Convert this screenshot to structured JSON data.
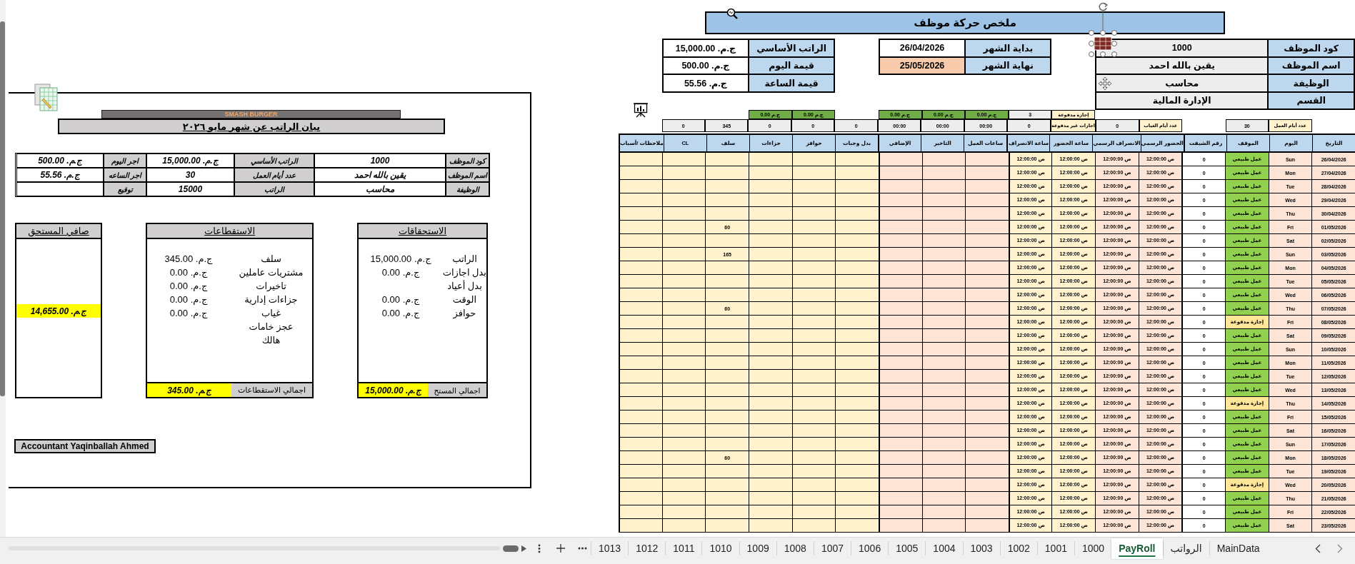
{
  "payslip": {
    "company": "SMASH BURGER",
    "title": "بيان الراتب عن شهر مايو ٢٠٢٦",
    "info_rows": [
      [
        {
          "label": "كود الموظف",
          "value": "1000"
        },
        {
          "label": "الراتب الأساسي",
          "value": "ج.م. 15,000.00"
        },
        {
          "label": "اجر اليوم",
          "value": "ج.م. 500.00"
        }
      ],
      [
        {
          "label": "اسم الموظف",
          "value": "يقين بالله احمد"
        },
        {
          "label": "عدد أيام العمل",
          "value": "30"
        },
        {
          "label": "اجر الساعه",
          "value": "ج.م. 55.56"
        }
      ],
      [
        {
          "label": "الوظيفة",
          "value": "محاسب"
        },
        {
          "label": "الراتب",
          "value": "15000"
        },
        {
          "label": "توقيع"
        }
      ]
    ],
    "earnings": {
      "title": "الاستحقاقات",
      "items": [
        {
          "label": "الراتب",
          "value": "ج.م. 15,000.00"
        },
        {
          "label": "بدل اجازات",
          "value": "ج.م. 0.00"
        },
        {
          "label": "بدل أعياد"
        },
        {
          "label": "الوقت",
          "value": "ج.م. 0.00"
        },
        {
          "label": "حوافز",
          "value": "ج.م. 0.00"
        }
      ],
      "total_label": "اجمالي المستح",
      "total": "ج.م. 15,000.00"
    },
    "deductions": {
      "title": "الاستقطاعات",
      "items": [
        {
          "label": "سلف",
          "value": "ج.م. 345.00"
        },
        {
          "label": "مشتريات عاملين",
          "value": "ج.م. 0.00"
        },
        {
          "label": "تاخيرات",
          "value": "ج.م. 0.00"
        },
        {
          "label": "جزاءات إدارية",
          "value": "ج.م. 0.00"
        },
        {
          "label": "غياب",
          "value": "ج.م. 0.00"
        },
        {
          "label": "عجز خامات"
        },
        {
          "label": "هالك"
        }
      ],
      "total_label": "اجمالي الاستقطاعات",
      "total": "ج.م. 345.00"
    },
    "net": {
      "title": "صافي المستحق",
      "value": "ج.م. 14,655.00"
    },
    "signature": "Accountant Yaqinballah Ahmed"
  },
  "summary": {
    "title": "ملخص حركة موظف",
    "employee_rows": [
      {
        "label": "كود الموظف",
        "value": "1000"
      },
      {
        "label": "اسم الموظف",
        "value": "يقين بالله احمد"
      },
      {
        "label": "الوظيفة",
        "value": "محاسب"
      },
      {
        "label": "القسم",
        "value": "الإدارة المالية"
      }
    ],
    "period_rows": [
      {
        "label": "بداية الشهر",
        "value": "26/04/2026",
        "highlighted": false
      },
      {
        "label": "نهاية الشهر",
        "value": "25/05/2026",
        "highlighted": true
      }
    ],
    "salary_rows": [
      {
        "label": "الراتب الأساسي",
        "value": "ج.م. 15,000.00"
      },
      {
        "label": "قيمة اليوم",
        "value": "ج.م. 500.00"
      },
      {
        "label": "قيمة الساعة",
        "value": "ج.م. 55.56"
      }
    ]
  },
  "attendance": {
    "columns": [
      {
        "label": "التاريخ",
        "kind": "date"
      },
      {
        "label": "اليوم",
        "kind": "day",
        "summary": {
          "kind": "label",
          "text": "عدد أيام العمل"
        }
      },
      {
        "label": "الموقف",
        "kind": "status",
        "summary": {
          "kind": "value",
          "text": "30"
        }
      },
      {
        "label": "رقم الشيفت",
        "kind": "shift"
      },
      {
        "label": "الحضور الرسمي",
        "kind": "official_in",
        "summary": {
          "kind": "label",
          "text": "عدد أيام الغياب"
        }
      },
      {
        "label": "الانصراف الرسمي",
        "kind": "official_out",
        "summary": {
          "kind": "value",
          "text": "0"
        }
      },
      {
        "label": "ساعة الحضور",
        "kind": "actual_in",
        "summary": {
          "kind": "label",
          "text": "اجازات غير مدفوعة"
        },
        "top": {
          "kind": "label",
          "text": "إجازة مدفوعة"
        }
      },
      {
        "label": "ساعة الانصراف",
        "kind": "actual_out",
        "summary": {
          "kind": "value",
          "text": "0"
        },
        "top": {
          "kind": "value",
          "text": "3"
        }
      },
      {
        "label": "ساعات العمل",
        "kind": "work_hours",
        "summary": {
          "kind": "value",
          "text": "00:00"
        },
        "top": {
          "kind": "money",
          "text": "ج.م 0.00"
        }
      },
      {
        "label": "التاخير",
        "kind": "delay",
        "summary": {
          "kind": "value",
          "text": "00:00"
        },
        "top": {
          "kind": "money",
          "text": "ج.م 0.00"
        }
      },
      {
        "label": "الإضافي",
        "kind": "overtime",
        "summary": {
          "kind": "value",
          "text": "00:00"
        },
        "top": {
          "kind": "money",
          "text": "ج.م 0.00"
        }
      },
      {
        "label": "بدل وجبات",
        "kind": "meal",
        "summary": {
          "kind": "value",
          "text": "0"
        }
      },
      {
        "label": "حوافز",
        "kind": "bonus",
        "summary": {
          "kind": "value",
          "text": "0"
        },
        "top": {
          "kind": "money",
          "text": "ج.م 0.00"
        }
      },
      {
        "label": "جزاءات",
        "kind": "penalty",
        "summary": {
          "kind": "value",
          "text": "0"
        },
        "top": {
          "kind": "money",
          "text": "ج.م 0.00"
        }
      },
      {
        "label": "سلف",
        "kind": "advance",
        "summary": {
          "kind": "value",
          "text": "345"
        }
      },
      {
        "label": "CL",
        "kind": "cl",
        "summary": {
          "kind": "value",
          "text": "0"
        }
      },
      {
        "label": "ملاحظات /أسباب",
        "kind": "notes"
      }
    ],
    "rows": [
      {
        "date": "26/04/2026",
        "day": "Sun",
        "status": "عمل طبيعي",
        "color": "#92d050",
        "shift": "0",
        "official_in": "12:00:00 ص",
        "official_out": "12:00:00 ص",
        "actual_in": "12:00:00 ص",
        "actual_out": "12:00:00 ص"
      },
      {
        "date": "27/04/2026",
        "day": "Mon",
        "status": "عمل طبيعي",
        "color": "#92d050",
        "shift": "0",
        "official_in": "12:00:00 ص",
        "official_out": "12:00:00 ص",
        "actual_in": "12:00:00 ص",
        "actual_out": "12:00:00 ص"
      },
      {
        "date": "28/04/2026",
        "day": "Tue",
        "status": "عمل طبيعي",
        "color": "#92d050",
        "shift": "0",
        "official_in": "12:00:00 ص",
        "official_out": "12:00:00 ص",
        "actual_in": "12:00:00 ص",
        "actual_out": "12:00:00 ص"
      },
      {
        "date": "29/04/2026",
        "day": "Wed",
        "status": "عمل طبيعي",
        "color": "#92d050",
        "shift": "0",
        "official_in": "12:00:00 ص",
        "official_out": "12:00:00 ص",
        "actual_in": "12:00:00 ص",
        "actual_out": "12:00:00 ص"
      },
      {
        "date": "30/04/2026",
        "day": "Thu",
        "status": "عمل طبيعي",
        "color": "#92d050",
        "shift": "0",
        "official_in": "12:00:00 ص",
        "official_out": "12:00:00 ص",
        "actual_in": "12:00:00 ص",
        "actual_out": "12:00:00 ص"
      },
      {
        "date": "01/05/2026",
        "day": "Fri",
        "status": "عمل طبيعي",
        "color": "#92d050",
        "shift": "0",
        "official_in": "12:00:00 ص",
        "official_out": "12:00:00 ص",
        "actual_in": "12:00:00 ص",
        "actual_out": "12:00:00 ص",
        "advance": "60"
      },
      {
        "date": "02/05/2026",
        "day": "Sat",
        "status": "عمل طبيعي",
        "color": "#92d050",
        "shift": "0",
        "official_in": "12:00:00 ص",
        "official_out": "12:00:00 ص",
        "actual_in": "12:00:00 ص",
        "actual_out": "12:00:00 ص"
      },
      {
        "date": "03/05/2026",
        "day": "Sun",
        "status": "عمل طبيعي",
        "color": "#92d050",
        "shift": "0",
        "official_in": "12:00:00 ص",
        "official_out": "12:00:00 ص",
        "actual_in": "12:00:00 ص",
        "actual_out": "12:00:00 ص",
        "advance": "165"
      },
      {
        "date": "04/05/2026",
        "day": "Mon",
        "status": "عمل طبيعي",
        "color": "#92d050",
        "shift": "0",
        "official_in": "12:00:00 ص",
        "official_out": "12:00:00 ص",
        "actual_in": "12:00:00 ص",
        "actual_out": "12:00:00 ص"
      },
      {
        "date": "05/05/2026",
        "day": "Tue",
        "status": "عمل طبيعي",
        "color": "#92d050",
        "shift": "0",
        "official_in": "12:00:00 ص",
        "official_out": "12:00:00 ص",
        "actual_in": "12:00:00 ص",
        "actual_out": "12:00:00 ص"
      },
      {
        "date": "06/05/2026",
        "day": "Wed",
        "status": "عمل طبيعي",
        "color": "#92d050",
        "shift": "0",
        "official_in": "12:00:00 ص",
        "official_out": "12:00:00 ص",
        "actual_in": "12:00:00 ص",
        "actual_out": "12:00:00 ص"
      },
      {
        "date": "07/05/2026",
        "day": "Thu",
        "status": "عمل طبيعي",
        "color": "#92d050",
        "shift": "0",
        "official_in": "12:00:00 ص",
        "official_out": "12:00:00 ص",
        "actual_in": "12:00:00 ص",
        "actual_out": "12:00:00 ص",
        "advance": "60"
      },
      {
        "date": "08/05/2026",
        "day": "Fri",
        "status": "إجازة مدفوعة",
        "color": "#ffe699",
        "shift": "0",
        "official_in": "12:00:00 ص",
        "official_out": "12:00:00 ص",
        "actual_in": "12:00:00 ص",
        "actual_out": "12:00:00 ص"
      },
      {
        "date": "09/05/2026",
        "day": "Sat",
        "status": "عمل طبيعي",
        "color": "#92d050",
        "shift": "0",
        "official_in": "12:00:00 ص",
        "official_out": "12:00:00 ص",
        "actual_in": "12:00:00 ص",
        "actual_out": "12:00:00 ص"
      },
      {
        "date": "10/05/2026",
        "day": "Sun",
        "status": "عمل طبيعي",
        "color": "#92d050",
        "shift": "0",
        "official_in": "12:00:00 ص",
        "official_out": "12:00:00 ص",
        "actual_in": "12:00:00 ص",
        "actual_out": "12:00:00 ص"
      },
      {
        "date": "11/05/2026",
        "day": "Mon",
        "status": "عمل طبيعي",
        "color": "#92d050",
        "shift": "0",
        "official_in": "12:00:00 ص",
        "official_out": "12:00:00 ص",
        "actual_in": "12:00:00 ص",
        "actual_out": "12:00:00 ص"
      },
      {
        "date": "12/05/2026",
        "day": "Tue",
        "status": "عمل طبيعي",
        "color": "#92d050",
        "shift": "0",
        "official_in": "12:00:00 ص",
        "official_out": "12:00:00 ص",
        "actual_in": "12:00:00 ص",
        "actual_out": "12:00:00 ص"
      },
      {
        "date": "13/05/2026",
        "day": "Wed",
        "status": "عمل طبيعي",
        "color": "#92d050",
        "shift": "0",
        "official_in": "12:00:00 ص",
        "official_out": "12:00:00 ص",
        "actual_in": "12:00:00 ص",
        "actual_out": "12:00:00 ص"
      },
      {
        "date": "14/05/2026",
        "day": "Thu",
        "status": "إجازة مدفوعة",
        "color": "#ffe699",
        "shift": "0",
        "official_in": "12:00:00 ص",
        "official_out": "12:00:00 ص",
        "actual_in": "12:00:00 ص",
        "actual_out": "12:00:00 ص"
      },
      {
        "date": "15/05/2026",
        "day": "Fri",
        "status": "عمل طبيعي",
        "color": "#92d050",
        "shift": "0",
        "official_in": "12:00:00 ص",
        "official_out": "12:00:00 ص",
        "actual_in": "12:00:00 ص",
        "actual_out": "12:00:00 ص"
      },
      {
        "date": "16/05/2026",
        "day": "Sat",
        "status": "عمل طبيعي",
        "color": "#92d050",
        "shift": "0",
        "official_in": "12:00:00 ص",
        "official_out": "12:00:00 ص",
        "actual_in": "12:00:00 ص",
        "actual_out": "12:00:00 ص"
      },
      {
        "date": "17/05/2026",
        "day": "Sun",
        "status": "عمل طبيعي",
        "color": "#92d050",
        "shift": "0",
        "official_in": "12:00:00 ص",
        "official_out": "12:00:00 ص",
        "actual_in": "12:00:00 ص",
        "actual_out": "12:00:00 ص"
      },
      {
        "date": "18/05/2026",
        "day": "Mon",
        "status": "عمل طبيعي",
        "color": "#92d050",
        "shift": "0",
        "official_in": "12:00:00 ص",
        "official_out": "12:00:00 ص",
        "actual_in": "12:00:00 ص",
        "actual_out": "12:00:00 ص",
        "advance": "60"
      },
      {
        "date": "19/05/2026",
        "day": "Tue",
        "status": "عمل طبيعي",
        "color": "#92d050",
        "shift": "0",
        "official_in": "12:00:00 ص",
        "official_out": "12:00:00 ص",
        "actual_in": "12:00:00 ص",
        "actual_out": "12:00:00 ص"
      },
      {
        "date": "20/05/2026",
        "day": "Wed",
        "status": "إجازة مدفوعة",
        "color": "#ffe699",
        "shift": "0",
        "official_in": "12:00:00 ص",
        "official_out": "12:00:00 ص",
        "actual_in": "12:00:00 ص",
        "actual_out": "12:00:00 ص"
      },
      {
        "date": "21/05/2026",
        "day": "Thu",
        "status": "عمل طبيعي",
        "color": "#92d050",
        "shift": "0",
        "official_in": "12:00:00 ص",
        "official_out": "12:00:00 ص",
        "actual_in": "12:00:00 ص",
        "actual_out": "12:00:00 ص"
      },
      {
        "date": "22/05/2026",
        "day": "Fri",
        "status": "عمل طبيعي",
        "color": "#92d050",
        "shift": "0",
        "official_in": "12:00:00 ص",
        "official_out": "12:00:00 ص",
        "actual_in": "12:00:00 ص",
        "actual_out": "12:00:00 ص"
      },
      {
        "date": "23/05/2026",
        "day": "Sat",
        "status": "عمل طبيعي",
        "color": "#92d050",
        "shift": "0",
        "official_in": "12:00:00 ص",
        "official_out": "12:00:00 ص",
        "actual_in": "12:00:00 ص",
        "actual_out": "12:00:00 ص"
      }
    ]
  },
  "sheet_tabs": [
    {
      "label": "MainData",
      "selected": false
    },
    {
      "label": "الرواتب",
      "selected": false
    },
    {
      "label": "PayRoll",
      "selected": true
    },
    {
      "label": "1000",
      "selected": false
    },
    {
      "label": "1001",
      "selected": false
    },
    {
      "label": "1002",
      "selected": false
    },
    {
      "label": "1003",
      "selected": false
    },
    {
      "label": "1004",
      "selected": false
    },
    {
      "label": "1005",
      "selected": false
    },
    {
      "label": "1006",
      "selected": false
    },
    {
      "label": "1007",
      "selected": false
    },
    {
      "label": "1008",
      "selected": false
    },
    {
      "label": "1009",
      "selected": false
    },
    {
      "label": "1010",
      "selected": false
    },
    {
      "label": "1011",
      "selected": false
    },
    {
      "label": "1012",
      "selected": false
    },
    {
      "label": "1013",
      "selected": false
    }
  ]
}
